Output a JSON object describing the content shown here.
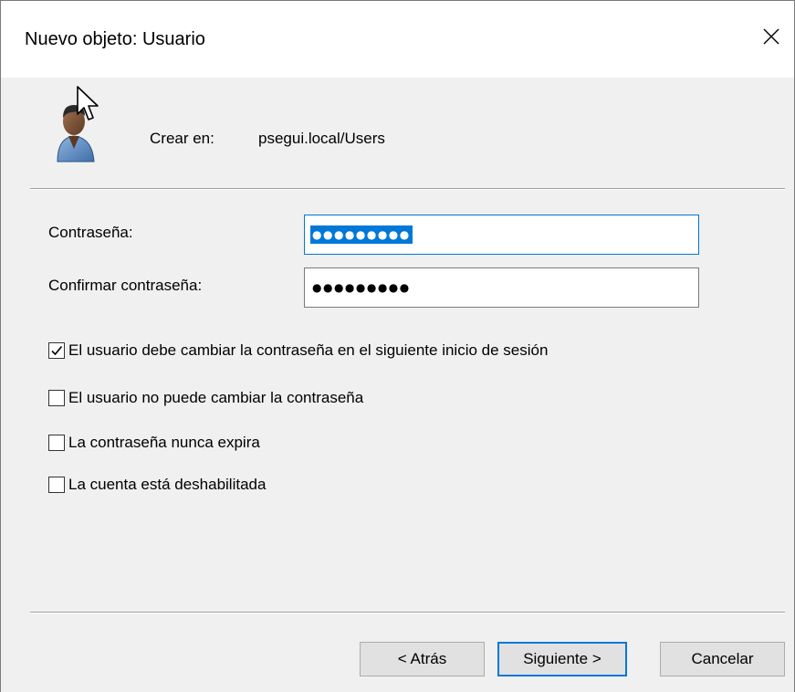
{
  "window": {
    "title": "Nuevo objeto: Usuario",
    "close_glyph": "✕"
  },
  "location": {
    "label": "Crear en:",
    "value": "psegui.local/Users"
  },
  "password": {
    "label": "Contraseña:",
    "masked_value": "●●●●●●●●●"
  },
  "confirm_password": {
    "label": "Confirmar contraseña:",
    "masked_value": "●●●●●●●●●"
  },
  "options": [
    {
      "label": "El usuario debe cambiar la contraseña en el siguiente inicio de sesión",
      "checked": true
    },
    {
      "label": "El usuario no puede cambiar la contraseña",
      "checked": false
    },
    {
      "label": "La contraseña nunca expira",
      "checked": false
    },
    {
      "label": "La cuenta está deshabilitada",
      "checked": false
    }
  ],
  "buttons": {
    "back": "< Atrás",
    "next": "Siguiente >",
    "cancel": "Cancelar"
  },
  "colors": {
    "accent": "#0078d7",
    "dialog_bg": "#f0f0f0",
    "button_bg": "#e1e1e1"
  }
}
